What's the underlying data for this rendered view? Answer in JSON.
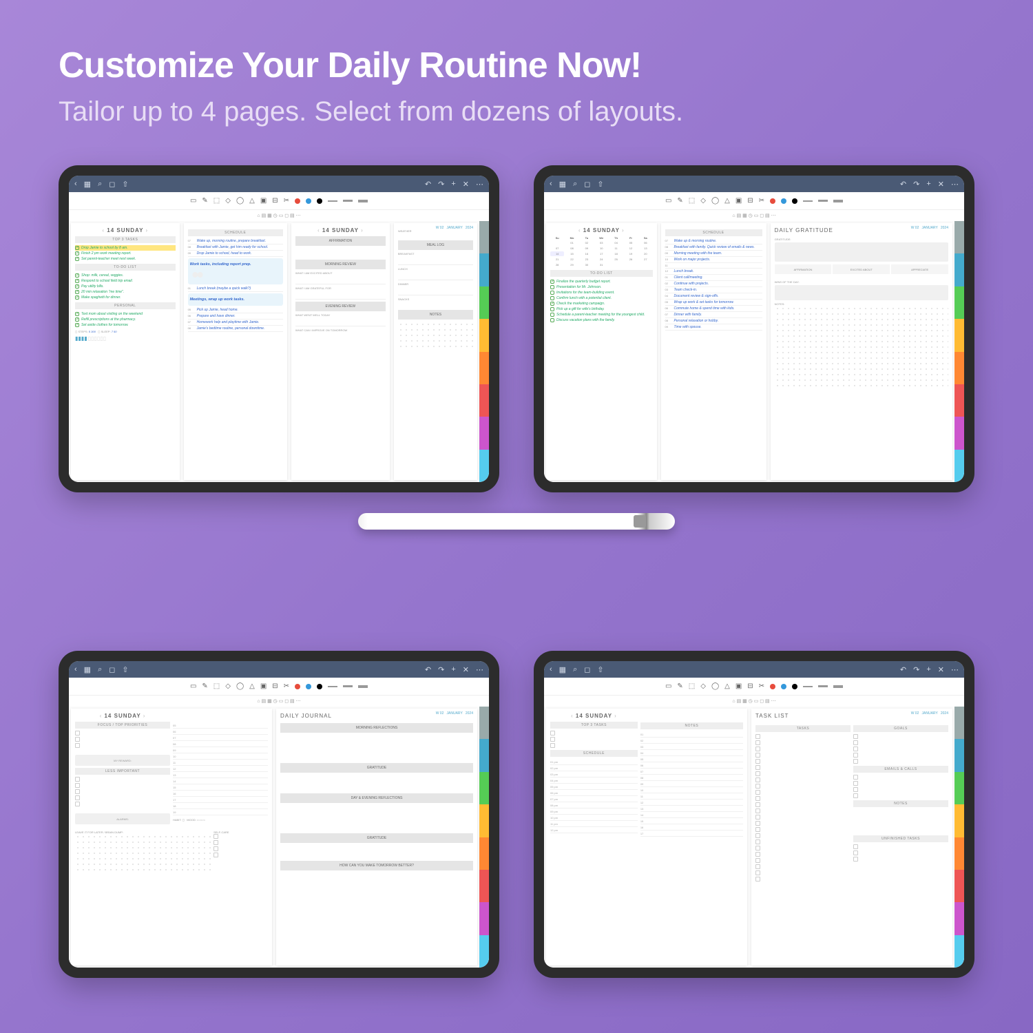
{
  "headline": "Customize Your Daily Routine Now!",
  "subhead": "Tailor up to 4 pages. Select from dozens of layouts.",
  "common": {
    "date_title": "14 SUNDAY",
    "meta_week": "W 02",
    "meta_month": "JANUARY",
    "meta_year": "2024"
  },
  "p1": {
    "left": {
      "top3_hdr": "TOP 3 TASKS",
      "tasks": [
        "Drop Jamie to school by 8 am.",
        "Finish 2 pm work meeting report.",
        "Set parent-teacher meet next week."
      ],
      "todo_hdr": "TO-DO LIST",
      "todos": [
        "Shop: milk, cereal, veggies.",
        "Respond to school field trip email.",
        "Pay utility bills.",
        "20 min relaxation \"me time\".",
        "Make spaghetti for dinner."
      ],
      "personal_hdr": "PERSONAL",
      "personal": [
        "Text mom about visiting on the weekend",
        "Refill prescriptions at the pharmacy.",
        "Set aside clothes for tomorrow."
      ],
      "steps_lbl": "STEPS:",
      "steps_val": "5 300",
      "sleep_lbl": "SLEEP:",
      "sleep_val": "7 50"
    },
    "mid": {
      "schedule_hdr": "SCHEDULE",
      "rows": [
        {
          "t": "07",
          "txt": "Wake up, morning routine, prepare breakfast."
        },
        {
          "t": "08",
          "txt": "Breakfast with Jamie, get him ready for school."
        },
        {
          "t": "09",
          "txt": "Drop Jamie to school, head to work."
        },
        {
          "t": "10",
          "txt": ""
        },
        {
          "t": "11",
          "txt": ""
        },
        {
          "t": "12",
          "txt": ""
        },
        {
          "t": "01",
          "txt": "Lunch break (maybe a quick walk?)"
        },
        {
          "t": "02",
          "txt": ""
        },
        {
          "t": "03",
          "txt": ""
        },
        {
          "t": "04",
          "txt": ""
        },
        {
          "t": "05",
          "txt": "Pick up Jamie, head home."
        },
        {
          "t": "06",
          "txt": "Prepare and have dinner."
        },
        {
          "t": "07",
          "txt": "Homework help and playtime with Jamie."
        },
        {
          "t": "08",
          "txt": "Jamie's bedtime routine, personal downtime."
        }
      ],
      "note1": "Work tasks, including report prep.",
      "note2": "Meetings, wrap up work tasks."
    },
    "r1": {
      "aff_hdr": "AFFIRMATION",
      "mr_hdr": "MORNING REVIEW",
      "excited": "WHAT I AM EXCITED ABOUT",
      "grateful": "WHAT I AM GRATEFUL FOR",
      "er_hdr": "EVENING REVIEW",
      "well": "WHAT WENT WELL TODAY",
      "improve": "WHAT CAN I IMPROVE ON TOMORROW"
    },
    "r2": {
      "weather": "WEATHER",
      "meal": "MEAL LOG",
      "bfast": "BREAKFAST",
      "lunch": "LUNCH",
      "dinner": "DINNER",
      "snacks": "SNACKS",
      "notes": "NOTES"
    }
  },
  "p2": {
    "cal_hdrs": [
      "Su",
      "Mo",
      "Tu",
      "We",
      "Th",
      "Fr",
      "Sa"
    ],
    "left": {
      "todo_hdr": "TO-DO LIST",
      "todos": [
        "Finalize the quarterly budget report.",
        "Presentation for Mr. Johnson.",
        "Invitations for the team-building event.",
        "Confirm lunch with a potential client.",
        "Check the marketing campaign.",
        "Pick up a gift for wife's birthday.",
        "Schedule a parent-teacher meeting for the youngest child.",
        "Discuss vacation plans with the family."
      ]
    },
    "mid": {
      "schedule_hdr": "SCHEDULE",
      "rows": [
        {
          "t": "07",
          "txt": "Wake up & morning routine."
        },
        {
          "t": "08",
          "txt": "Breakfast with family. Quick review of emails & news."
        },
        {
          "t": "09",
          "txt": "Morning meeting with the team."
        },
        {
          "t": "10",
          "txt": "Work on major projects."
        },
        {
          "t": "11",
          "txt": ""
        },
        {
          "t": "12",
          "txt": "Lunch break."
        },
        {
          "t": "01",
          "txt": "Client call/meeting."
        },
        {
          "t": "02",
          "txt": "Continue with projects."
        },
        {
          "t": "03",
          "txt": "Team check-in."
        },
        {
          "t": "04",
          "txt": "Document review & sign-offs."
        },
        {
          "t": "05",
          "txt": "Wrap up work & set tasks for tomorrow."
        },
        {
          "t": "06",
          "txt": "Commute home & spend time with kids."
        },
        {
          "t": "07",
          "txt": "Dinner with family."
        },
        {
          "t": "08",
          "txt": "Personal relaxation or hobby."
        },
        {
          "t": "09",
          "txt": "Time with spouse."
        }
      ]
    },
    "right": {
      "title": "DAILY GRATITUDE",
      "grat_hdr": "GRATITUDE:",
      "btns": [
        "AFFIRMATION",
        "EXCITED ABOUT",
        "APPRECIATE"
      ],
      "wins_hdr": "WINS OF THE DAY:",
      "notes_hdr": "NOTES:"
    }
  },
  "p3": {
    "left": {
      "focus_hdr": "FOCUS / TOP PRIORITIES",
      "reward_hdr": "MY REWARD:",
      "less_hdr": "LESS IMPORTANT",
      "alarms_hdr": "ALARMS:",
      "habit_lbl": "HABIT:",
      "mood_lbl": "MOOD:",
      "later_hdr": "LEAVE IT FOR LATER / BRAIN DUMP:",
      "selfcare_hdr": "SELF-CARE"
    },
    "right": {
      "title": "DAILY JOURNAL",
      "sects": [
        "MORNING REFLECTIONS",
        "GRATITUDE",
        "DAY & EVENING REFLECTIONS",
        "GRATITUDE",
        "HOW CAN YOU MAKE TOMORROW BETTER?"
      ]
    }
  },
  "p4": {
    "left": {
      "top3_hdr": "TOP 3 TASKS",
      "sched_hdr": "SCHEDULE",
      "hours": [
        "01 pm",
        "02 pm",
        "03 pm",
        "04 pm",
        "05 pm",
        "06 pm",
        "07 pm",
        "08 pm",
        "09 pm",
        "10 pm",
        "11 pm",
        "12 pm"
      ],
      "notes_hdr": "NOTES"
    },
    "right": {
      "title": "TASK LIST",
      "tasks_hdr": "TASKS",
      "goals_hdr": "GOALS",
      "emails_hdr": "EMAILS & CALLS",
      "notes_hdr": "NOTES",
      "unfin_hdr": "UNFINISHED TASKS"
    }
  }
}
